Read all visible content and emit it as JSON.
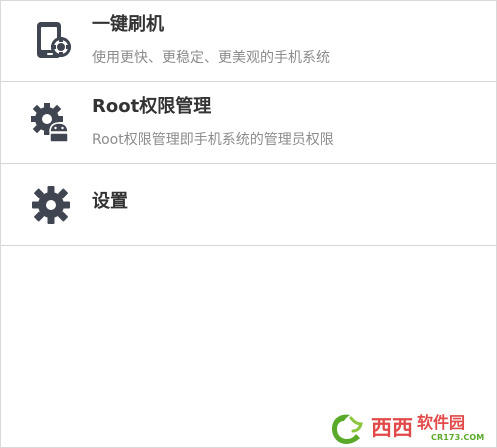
{
  "menu": {
    "items": [
      {
        "title": "一键刷机",
        "subtitle": "使用更快、更稳定、更美观的手机系统",
        "icon": "phone-flash-icon"
      },
      {
        "title": "Root权限管理",
        "subtitle": "Root权限管理即手机系统的管理员权限",
        "icon": "android-gear-icon"
      },
      {
        "title": "设置",
        "subtitle": "",
        "icon": "gear-icon"
      }
    ]
  },
  "watermark": {
    "brand": "西西软件园",
    "url": "CR173.COM"
  },
  "colors": {
    "icon": "#3f4651",
    "title": "#333333",
    "subtitle": "#8c8c8c",
    "divider": "#d7d7d7",
    "watermark_green": "#5aaa2a",
    "watermark_red": "#e24a4a"
  }
}
